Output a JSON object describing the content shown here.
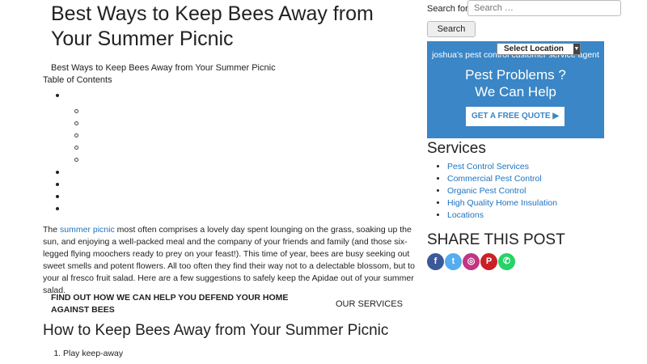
{
  "article": {
    "title": "Best Ways to Keep Bees Away from Your Summer Picnic",
    "toc_small_title": "Best Ways to Keep Bees Away from Your Summer Picnic",
    "toc_label": "Table of Contents",
    "intro_link": "summer picnic",
    "intro_prefix": "The ",
    "intro_rest": " most often comprises a lovely day spent lounging on the grass, soaking up the sun, and enjoying a well-packed meal and the company of your friends and family (and those six-legged flying moochers ready to prey on your feast!). This time of year, bees are busy seeking out sweet smells and potent flowers. All too often they find their way not to a delectable blossom, but to your al fresco fruit salad. Here are a few suggestions to safely keep the Apidae out of your summer salad.",
    "cta": "FIND OUT HOW WE CAN HELP YOU DEFEND YOUR HOME AGAINST BEES",
    "services_link": "OUR SERVICES",
    "section_heading": "How to Keep Bees Away from Your Summer Picnic",
    "steps": [
      "Play keep-away"
    ]
  },
  "sidebar": {
    "search_label": "Search for:",
    "search_placeholder": "Search …",
    "search_button": "Search",
    "location_select": "Select Location",
    "agent_text": "joshua's pest control customer service agent",
    "headline_line1": "Pest Problems ?",
    "headline_line2": "We Can Help",
    "quote_button": "GET A FREE QUOTE",
    "services_heading": "Services",
    "services": [
      "Pest Control Services",
      "Commercial Pest Control",
      "Organic Pest Control",
      "High Quality Home Insulation",
      "Locations"
    ],
    "share_heading": "SHARE THIS POST",
    "share_icons": [
      "facebook-icon",
      "twitter-icon",
      "instagram-icon",
      "pinterest-icon",
      "whatsapp-icon"
    ]
  },
  "colors": {
    "promo_bg": "#3a86c6",
    "link": "#1e73be",
    "facebook": "#3b5998",
    "twitter": "#55acee",
    "instagram": "#c13584",
    "pinterest": "#cb2027",
    "whatsapp": "#25d366"
  }
}
